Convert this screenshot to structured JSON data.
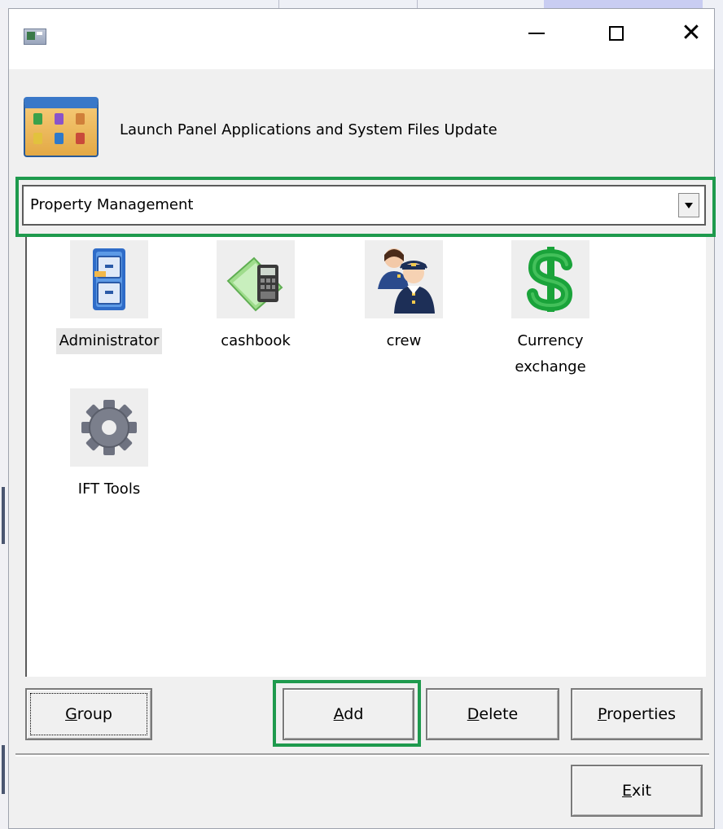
{
  "window": {
    "app_icon": "window-app-icon",
    "controls": {
      "minimize": "minimize-icon",
      "maximize": "maximize-icon",
      "close": "close-icon"
    }
  },
  "header": {
    "icon": "launch-panel-icon",
    "title": "Launch Panel Applications and System Files Update"
  },
  "group_select": {
    "selected_value": "Property Management",
    "arrow_icon": "dropdown-arrow-icon"
  },
  "applications": [
    {
      "label": "Administrator",
      "icon": "filing-cabinet-icon",
      "selected": true
    },
    {
      "label": "cashbook",
      "icon": "cashbook-calculator-icon",
      "selected": false
    },
    {
      "label": "crew",
      "icon": "crew-people-icon",
      "selected": false
    },
    {
      "label": "Currency exchange",
      "label_line1": "Currency",
      "label_line2": "exchange",
      "icon": "dollar-sign-icon",
      "selected": false
    },
    {
      "label": "IFT Tools",
      "icon": "gear-icon",
      "selected": false
    }
  ],
  "buttons": {
    "group": {
      "label": "Group",
      "mnemonic": "G",
      "rest": "roup"
    },
    "add": {
      "label": "Add",
      "mnemonic": "A",
      "rest": "dd"
    },
    "delete": {
      "label": "Delete",
      "mnemonic": "D",
      "rest": "elete"
    },
    "properties": {
      "label": "Properties",
      "mnemonic": "P",
      "rest": "roperties"
    },
    "exit": {
      "label": "Exit",
      "mnemonic": "E",
      "rest": "xit"
    }
  },
  "colors": {
    "highlight_frame": "#1e9a4d",
    "dollar_green": "#1aa33a",
    "window_bg": "#f0f0f0"
  }
}
